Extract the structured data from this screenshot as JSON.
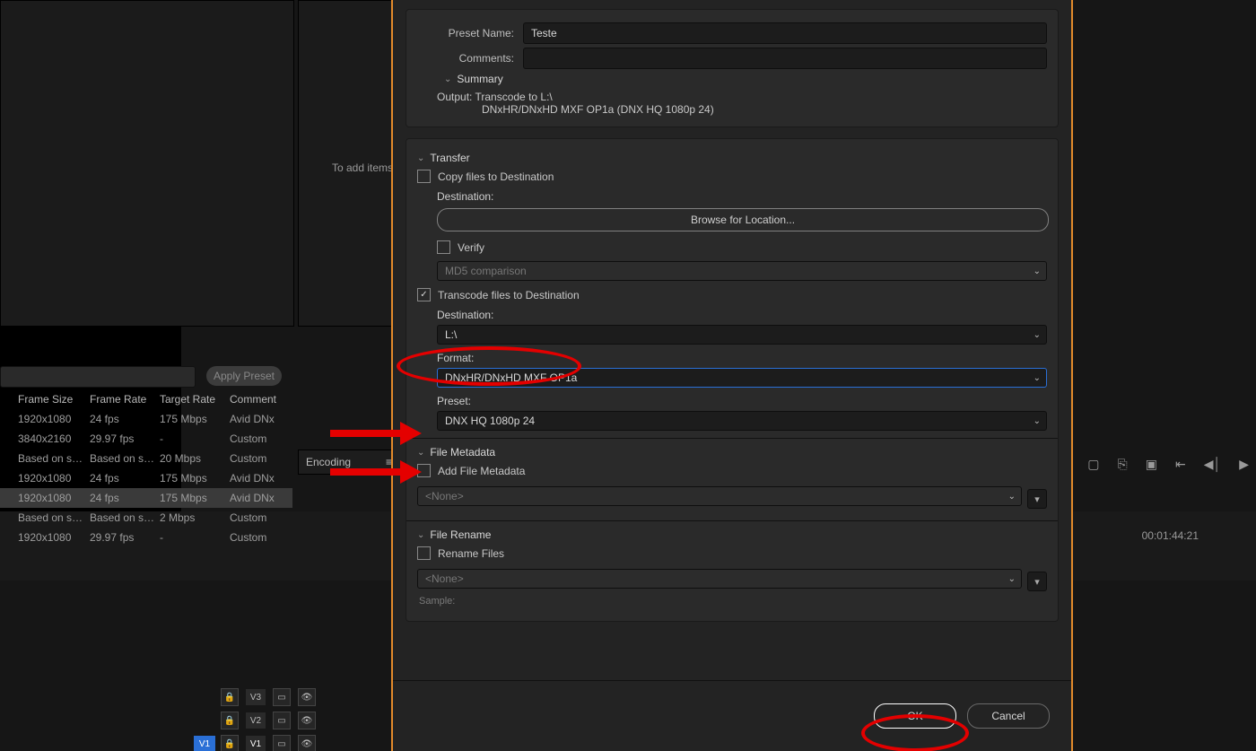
{
  "dialog": {
    "preset_name_label": "Preset Name:",
    "preset_name_value": "Teste",
    "comments_label": "Comments:",
    "comments_value": "",
    "summary_header": "Summary",
    "summary_output_label": "Output:",
    "summary_output_line1": "Transcode to L:\\",
    "summary_output_line2": "DNxHR/DNxHD MXF OP1a (DNX HQ 1080p 24)",
    "transfer": {
      "header": "Transfer",
      "copy_label": "Copy files to Destination",
      "destination_label": "Destination:",
      "browse_label": "Browse for Location...",
      "verify_label": "Verify",
      "verify_method": "MD5 comparison"
    },
    "transcode": {
      "checkbox_label": "Transcode files to Destination",
      "destination_label": "Destination:",
      "destination_value": "L:\\",
      "format_label": "Format:",
      "format_value": "DNxHR/DNxHD MXF OP1a",
      "preset_label": "Preset:",
      "preset_value": "DNX HQ 1080p 24"
    },
    "file_metadata": {
      "header": "File Metadata",
      "add_label": "Add File Metadata",
      "none": "<None>"
    },
    "file_rename": {
      "header": "File Rename",
      "rename_label": "Rename Files",
      "none": "<None>",
      "sample_label": "Sample:"
    },
    "ok": "OK",
    "cancel": "Cancel"
  },
  "background": {
    "add_items_hint": "To add items",
    "apply_preset": "Apply Preset",
    "encoding_header": "Encoding",
    "columns": {
      "frame_size": "Frame Size",
      "frame_rate": "Frame Rate",
      "target_rate": "Target Rate",
      "comment": "Comment"
    },
    "rows": [
      {
        "size": "1920x1080",
        "rate": "24 fps",
        "target": "175 Mbps",
        "comment": "Avid DNx"
      },
      {
        "size": "3840x2160",
        "rate": "29.97 fps",
        "target": "-",
        "comment": "Custom"
      },
      {
        "size": "Based on s…",
        "rate": "Based on s…",
        "target": "20 Mbps",
        "comment": "Custom"
      },
      {
        "size": "1920x1080",
        "rate": "24 fps",
        "target": "175 Mbps",
        "comment": "Avid DNx"
      },
      {
        "size": "1920x1080",
        "rate": "24 fps",
        "target": "175 Mbps",
        "comment": "Avid DNx"
      },
      {
        "size": "Based on s…",
        "rate": "Based on s…",
        "target": "2 Mbps",
        "comment": "Custom"
      },
      {
        "size": "1920x1080",
        "rate": "29.97 fps",
        "target": "-",
        "comment": "Custom"
      }
    ],
    "timecode": "00:01:44:21",
    "tracks": {
      "v3": "V3",
      "v2": "V2",
      "v1": "V1"
    }
  },
  "annotations": {
    "destination_ellipse": true,
    "format_arrow": true,
    "preset_arrow": true,
    "ok_ellipse": true
  }
}
